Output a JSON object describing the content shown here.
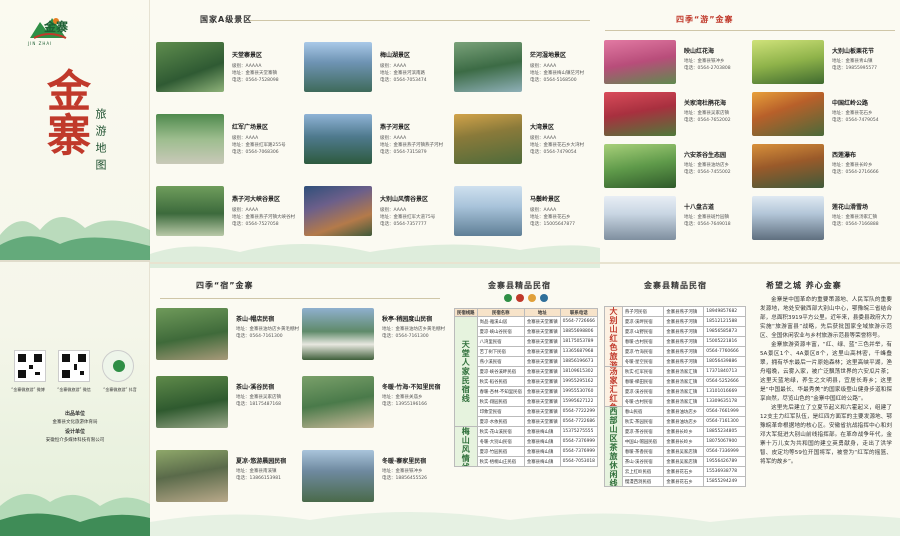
{
  "brand": {
    "logo_text": "金寨",
    "logo_sub": "JIN ZHAI",
    "big_title": "金寨",
    "sub_title": "旅游地图"
  },
  "qr_codes": [
    {
      "caption": "“金寨微旅游” 微博"
    },
    {
      "caption": "“金寨微旅游” 微信"
    },
    {
      "caption": "“金寨微旅游” 抖音"
    }
  ],
  "credits": {
    "org_label": "出品单位",
    "org": "金寨县文化旅游体育局",
    "design_label": "设计单位",
    "design": "安徽恒介多媒体科技有限公司"
  },
  "section_a": {
    "title": "国家A级景区",
    "spots": [
      {
        "name": "天堂寨景区",
        "grade": "级别：AAAAA",
        "addr": "地址：金寨县天堂寨镇",
        "tel": "电话：0564-7528098"
      },
      {
        "name": "梅山湖景区",
        "grade": "级别：AAAA",
        "addr": "地址：金寨县河滨南路",
        "tel": "电话：0564-7053474"
      },
      {
        "name": "茫河湿地景区",
        "grade": "级别：AAAA",
        "addr": "地址：金寨县梅山镇茫河村",
        "tel": "电话：0564-5168500"
      },
      {
        "name": "红军广场景区",
        "grade": "级别：AAAA",
        "addr": "地址：金寨县红军路255号",
        "tel": "电话：0564-7068306"
      },
      {
        "name": "燕子河景区",
        "grade": "级别：AAAA",
        "addr": "地址：金寨县燕子河镇燕子河村",
        "tel": "电话：0564-7315879"
      },
      {
        "name": "大湾景区",
        "grade": "级别：AAAA",
        "addr": "地址：金寨县花石乡大湾村",
        "tel": "电话：0564-7479054"
      },
      {
        "name": "燕子河大峡谷景区",
        "grade": "级别：AAAA",
        "addr": "地址：金寨县燕子河镇大峡谷村",
        "tel": "电话：0564-7527058"
      },
      {
        "name": "大别山风情谷景区",
        "grade": "级别：AAAA",
        "addr": "地址：金寨县红军大道75号",
        "tel": "电话：0564-7357777"
      },
      {
        "name": "马鬃岭景区",
        "grade": "级别：AAAA",
        "addr": "地址：金寨县花石乡",
        "tel": "电话：15005647877"
      }
    ]
  },
  "section_season": {
    "title": "四季“游”金寨",
    "spots": [
      {
        "name": "映山红花海",
        "addr": "地址：金寨县铁冲乡",
        "tel": "电话：0564-2703808"
      },
      {
        "name": "大别山板栗花节",
        "addr": "地址：金寨县青山镇",
        "tel": "电话：19855995577"
      },
      {
        "name": "关家湾杜鹃花海",
        "addr": "地址：金寨县吴家店镇",
        "tel": "电话：0564-7652002"
      },
      {
        "name": "中国红岭公路",
        "addr": "地址：金寨县花石乡",
        "tel": "电话：0564-7479054"
      },
      {
        "name": "六安茶谷生态园",
        "addr": "地址：金寨县油坊店乡",
        "tel": "电话：0564-7455002"
      },
      {
        "name": "西莲瀑布",
        "addr": "地址：金寨县长岭乡",
        "tel": "电话：0564-2716666"
      },
      {
        "name": "十八盘古道",
        "addr": "地址：金寨县斑竹园镇",
        "tel": "电话：0564-7649018"
      },
      {
        "name": "莲花山滑雪场",
        "addr": "地址：金寨县汤家汇镇",
        "tel": "电话：0564-7166888"
      }
    ]
  },
  "section_stay": {
    "title": "四季“宿”金寨",
    "items": [
      {
        "name": "茶山·帽店民宿",
        "addr": "地址：金寨县油坊店乡黄毛棚村",
        "tel": "电话：0564-7161300"
      },
      {
        "name": "秋亭·稍园度山民宿",
        "addr": "地址：金寨县油坊店乡黄毛棚村",
        "tel": "电话：0564-7161300"
      },
      {
        "name": "茶山·溪谷民宿",
        "addr": "地址：金寨县吴家店镇",
        "tel": "电话：18175487168"
      },
      {
        "name": "冬暖·竹海·不知里民宿",
        "addr": "地址：金寨县关庙乡",
        "tel": "电话：13955196166"
      },
      {
        "name": "夏凉·悠游晨园民宿",
        "addr": "地址：金寨县南溪镇",
        "tel": "电话：13866153981"
      },
      {
        "name": "冬暖·寨家里民宿",
        "addr": "地址：金寨县铁冲乡",
        "tel": "电话：18856455526"
      }
    ]
  },
  "section_homestay": {
    "title": "金寨县精品民宿",
    "title2": "金寨县精品民宿",
    "headers": [
      "民宿线路",
      "民宿名称",
      "地址",
      "联系电话"
    ],
    "route1": "天堂人家民宿线",
    "route2": "梅山风情线",
    "route3": "大别山红色旅游线",
    "route4": "汤家汇红色研学线",
    "route5": "西部山区茶旅休闲线",
    "left_rows": [
      {
        "name": "尚品·雅溪山居",
        "addr": "金寨县天堂寨镇",
        "tel": "0564-7726666"
      },
      {
        "name": "夏凉·峡山谷民宿",
        "addr": "金寨县天堂寨镇",
        "tel": "18855698806"
      },
      {
        "name": "八湾里民宿",
        "addr": "金寨县天堂寨镇",
        "tel": "18175053789"
      },
      {
        "name": "苦丁树下民宿",
        "addr": "金寨县天堂寨镇",
        "tel": "13365687968"
      },
      {
        "name": "燕小溪民宿",
        "addr": "金寨县天堂寨镇",
        "tel": "18856196673"
      },
      {
        "name": "夏凉·峡谷溪畔民宿",
        "addr": "金寨县天堂寨镇",
        "tel": "18109615302"
      },
      {
        "name": "秋实·稻谷民宿",
        "addr": "金寨县天堂寨镇",
        "tel": "19955295162"
      },
      {
        "name": "春暖·杏林·不知里民宿",
        "addr": "金寨县天堂寨镇",
        "tel": "19955530760"
      },
      {
        "name": "秋实·翔园民宿",
        "addr": "金寨县天堂寨镇",
        "tel": "15995627122"
      },
      {
        "name": "印象堂民宿",
        "addr": "金寨县天堂寨镇",
        "tel": "0564-7722299"
      },
      {
        "name": "夏凉·水依民宿",
        "addr": "金寨县天堂寨镇",
        "tel": "0564-7722686"
      },
      {
        "name": "秋实·花山溪民宿",
        "addr": "金寨县梅山镇",
        "tel": "15375275555"
      },
      {
        "name": "冬暖·大别山民宿",
        "addr": "金寨县梅山镇",
        "tel": "0564-7376999"
      },
      {
        "name": "夏凉·竹园民宿",
        "addr": "金寨县梅山镇",
        "tel": "0564-7376999"
      },
      {
        "name": "秋实·梧桐山庄民宿",
        "addr": "金寨县梅山镇",
        "tel": "0564-7053018"
      }
    ],
    "right_rows": [
      {
        "name": "燕子河民宿",
        "addr": "金寨县燕子河镇",
        "tel": "18949857682"
      },
      {
        "name": "夏凉·溪畔民宿",
        "addr": "金寨县燕子河镇",
        "tel": "18512121588"
      },
      {
        "name": "夏凉·山野民宿",
        "addr": "金寨县燕子河镇",
        "tel": "19856585873"
      },
      {
        "name": "春暖·古村民宿",
        "addr": "金寨县燕子河镇",
        "tel": "15005221816"
      },
      {
        "name": "夏凉·竹海民宿",
        "addr": "金寨县燕子河镇",
        "tel": "0564-7760666"
      },
      {
        "name": "冬暖·星空民宿",
        "addr": "金寨县燕子河镇",
        "tel": "18056439886"
      },
      {
        "name": "秋实·红军民宿",
        "addr": "金寨县汤家汇镇",
        "tel": "17371840713"
      },
      {
        "name": "春暖·梯田民宿",
        "addr": "金寨县汤家汇镇",
        "tel": "0564-5252666"
      },
      {
        "name": "夏凉·溪谷民宿",
        "addr": "金寨县汤家汇镇",
        "tel": "13101016669"
      },
      {
        "name": "冬暖·古村民宿",
        "addr": "金寨县汤家汇镇",
        "tel": "13309635178"
      },
      {
        "name": "春山民宿",
        "addr": "金寨县油坊店乡",
        "tel": "0564-7661999"
      },
      {
        "name": "秋实·茶园民宿",
        "addr": "金寨县油坊店乡",
        "tel": "0564-7161300"
      },
      {
        "name": "夏凉·茶谷民宿",
        "addr": "金寨县长岭乡",
        "tel": "18855234805"
      },
      {
        "name": "中国山·帽园民宿",
        "addr": "金寨县长岭乡",
        "tel": "18075067900"
      },
      {
        "name": "春暖·茶香民宿",
        "addr": "金寨县吴家店镇",
        "tel": "0564-7336999"
      },
      {
        "name": "茶山·溪谷民宿",
        "addr": "金寨县吴家店镇",
        "tel": "19556426789"
      },
      {
        "name": "云上红岭民宿",
        "addr": "金寨县花石乡",
        "tel": "15536938778"
      },
      {
        "name": "慢漫西洞民宿",
        "addr": "金寨县花石乡",
        "tel": "15855294249"
      }
    ]
  },
  "section_about": {
    "title": "希望之城  养心金寨",
    "paragraphs": [
      "金寨是中国革命的重要策源地、人民军队的重要发源地，地处安徽西部大别山中心，鄂豫皖三省结合部，总面积3919平方公里。近年来，县委县政府大力实施“旅游富县”战略，先后获批国家全域旅游示范区、全国休闲农业与乡村旅游示范县等荣誉称号。",
      "金寨旅游资源丰富，“红、绿、蓝”三色并举，有5A景区1个、4A景区8个，这里山高林密，千峰叠翠，拥有华东最后一片原始森林；这里高峡平湖，渔舟唱晚，云雾入家，被广泛飘荡世界的六安瓜片茶；这里天蓝地绿，养生之文明县，宜居长寿乡；这里是“中国最长、华最秀美”的国家级登山健身步道和探享自然，尽览山色的“金寨中国红岭公路”。",
      "这里先后建立了立夏节起义和六霍起义，组建了12支主力红军队伍，是红四方面军的主要发源地、鄂豫皖革命根据地的核心区。安徽省抗战指挥中心和刘邓大军挺进大别山前线指挥部。在革命战争年代，金寨十万儿女为共和国的建立英勇献身，走出了洪学智、皮定均等59位开国将军，被誉为“红军的摇篮、将军的故乡”。"
    ]
  }
}
